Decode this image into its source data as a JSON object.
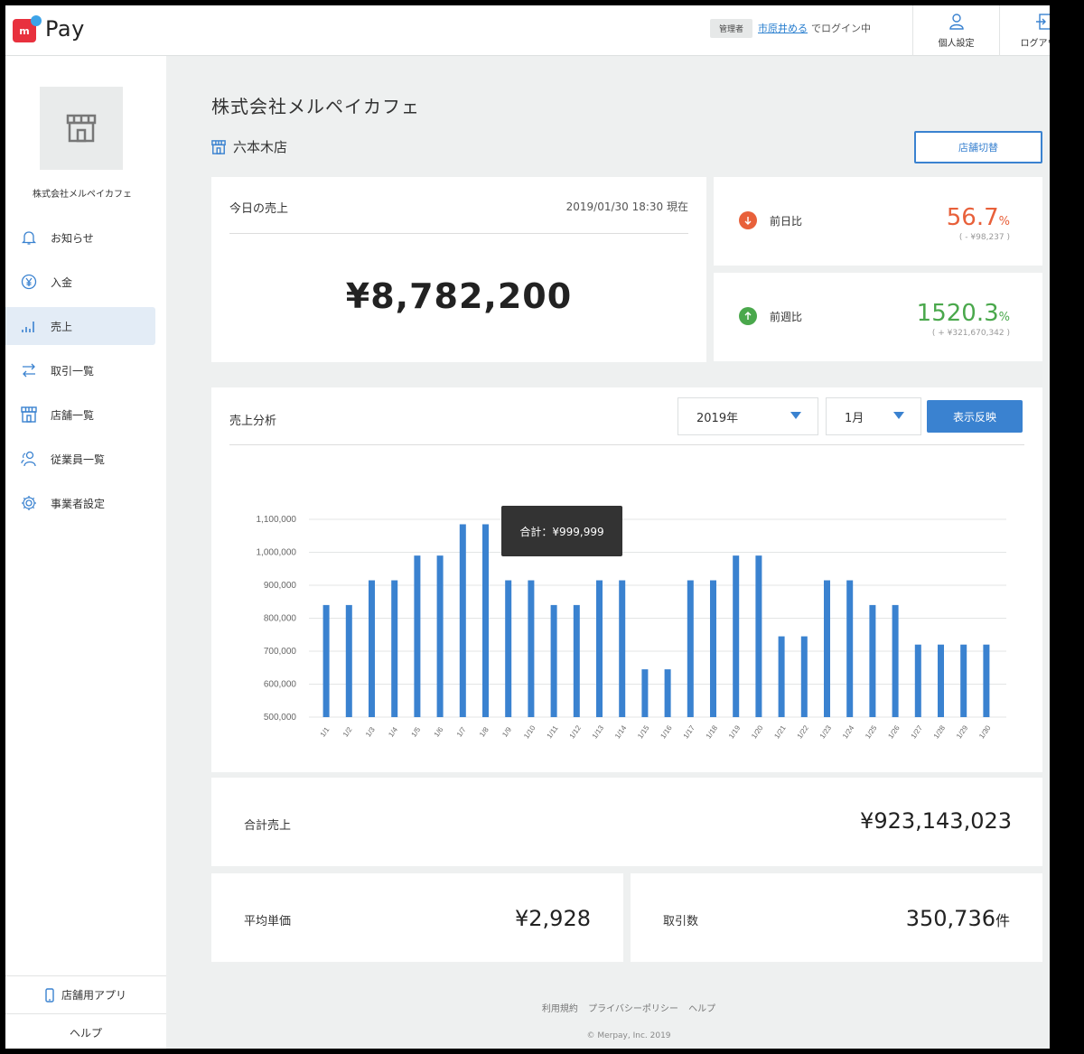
{
  "header": {
    "logo_text": "Pay",
    "role_badge": "管理者",
    "user_name": "市原井める",
    "login_suffix": "でログイン中",
    "profile_label": "個人設定",
    "logout_label": "ログアウト"
  },
  "sidebar": {
    "store_name": "株式会社メルペイカフェ",
    "items": [
      {
        "label": "お知らせ",
        "icon": "bell-icon"
      },
      {
        "label": "入金",
        "icon": "yen-circle-icon"
      },
      {
        "label": "売上",
        "icon": "bar-chart-icon",
        "active": true
      },
      {
        "label": "取引一覧",
        "icon": "transfer-icon"
      },
      {
        "label": "店舗一覧",
        "icon": "store-icon"
      },
      {
        "label": "従業員一覧",
        "icon": "people-icon"
      },
      {
        "label": "事業者設定",
        "icon": "gear-icon"
      }
    ],
    "app_label": "店舗用アプリ",
    "help_label": "ヘルプ"
  },
  "main": {
    "company": "株式会社メルペイカフェ",
    "branch": "六本木店",
    "switch_label": "店舗切替"
  },
  "today": {
    "label": "今日の売上",
    "timestamp": "2019/01/30 18:30 現在",
    "amount": "¥8,782,200"
  },
  "compare": {
    "day": {
      "label": "前日比",
      "value": "56.7",
      "unit": "%",
      "delta": "( - ¥98,237 )"
    },
    "week": {
      "label": "前週比",
      "value": "1520.3",
      "unit": "%",
      "delta": "( + ¥321,670,342 )"
    }
  },
  "analysis": {
    "label": "売上分析",
    "year": "2019年",
    "month": "1月",
    "apply_label": "表示反映",
    "tooltip": "合計：¥999,999"
  },
  "chart_data": {
    "type": "bar",
    "categories": [
      "1/1",
      "1/2",
      "1/3",
      "1/4",
      "1/5",
      "1/6",
      "1/7",
      "1/8",
      "1/9",
      "1/10",
      "1/11",
      "1/12",
      "1/13",
      "1/14",
      "1/15",
      "1/16",
      "1/17",
      "1/18",
      "1/19",
      "1/20",
      "1/21",
      "1/22",
      "1/23",
      "1/24",
      "1/25",
      "1/26",
      "1/27",
      "1/28",
      "1/29",
      "1/30"
    ],
    "values": [
      840000,
      840000,
      915000,
      915000,
      990000,
      990000,
      1085000,
      1085000,
      915000,
      915000,
      840000,
      840000,
      915000,
      915000,
      645000,
      645000,
      915000,
      915000,
      990000,
      990000,
      745000,
      745000,
      915000,
      915000,
      840000,
      840000,
      720000,
      720000,
      720000,
      720000
    ],
    "yticks": [
      "1,100,000",
      "1,000,000",
      "900,000",
      "800,000",
      "700,000",
      "600,000",
      "500,000"
    ],
    "ylim": [
      500000,
      1100000
    ],
    "color": "#3a82d0",
    "grid": true
  },
  "totals": {
    "total_label": "合計売上",
    "total_value": "¥923,143,023",
    "avg_label": "平均単価",
    "avg_value": "¥2,928",
    "count_label": "取引数",
    "count_value": "350,736",
    "count_unit": "件"
  },
  "footer": {
    "terms": "利用規約",
    "privacy": "プライバシーポリシー",
    "help": "ヘルプ",
    "copyright": "© Merpay, Inc. 2019"
  }
}
